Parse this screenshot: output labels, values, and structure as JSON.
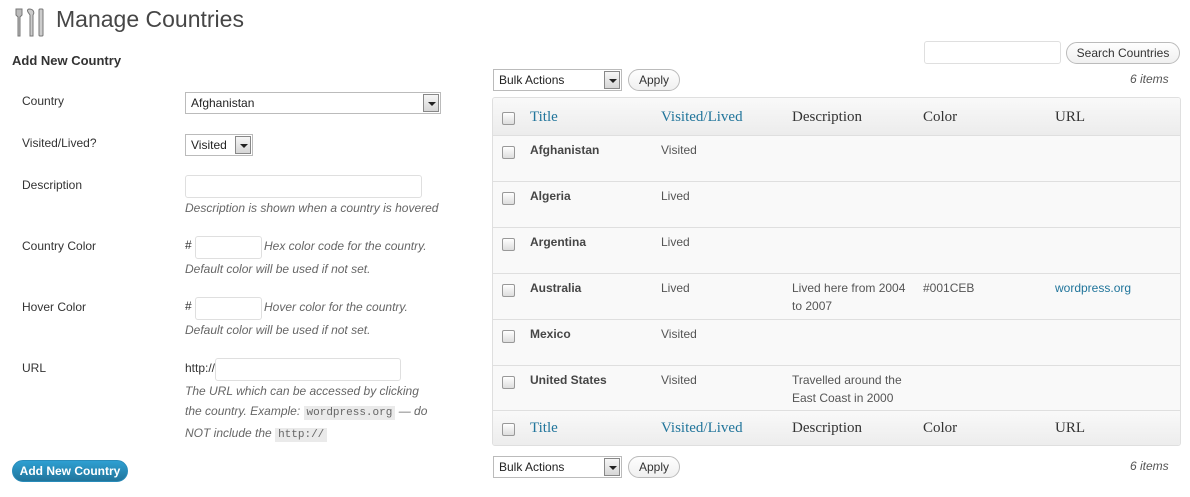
{
  "header": {
    "title": "Manage Countries",
    "icon": "tools-icon"
  },
  "form": {
    "heading": "Add New Country",
    "country_label": "Country",
    "country_value": "Afghanistan",
    "visited_label": "Visited/Lived?",
    "visited_value": "Visited",
    "description_label": "Description",
    "description_value": "",
    "description_hint": "Description is shown when a country is hovered",
    "country_color_label": "Country Color",
    "country_color_prefix": "#",
    "country_color_value": "",
    "country_color_hint_1": "Hex color code for the country.",
    "country_color_hint_2": "Default color will be used if not set.",
    "hover_color_label": "Hover Color",
    "hover_color_prefix": "#",
    "hover_color_value": "",
    "hover_color_hint_1": "Hover color for the country.",
    "hover_color_hint_2": "Default color will be used if not set.",
    "url_label": "URL",
    "url_prefix": "http://",
    "url_value": "",
    "url_hint_1": "The URL which can be accessed by clicking",
    "url_hint_2a": "the country. Example:",
    "url_hint_2_code": "wordpress.org",
    "url_hint_2b": "— do",
    "url_hint_3a": "NOT include the",
    "url_hint_3_code": "http://",
    "submit_label": "Add New Country"
  },
  "search": {
    "value": "",
    "button_label": "Search Countries"
  },
  "bulk": {
    "top_label": "Bulk Actions",
    "top_apply": "Apply",
    "bottom_label": "Bulk Actions",
    "bottom_apply": "Apply",
    "items_count_top": "6 items",
    "items_count_bottom": "6 items"
  },
  "table": {
    "columns": [
      "Title",
      "Visited/Lived",
      "Description",
      "Color",
      "URL"
    ],
    "rows": [
      {
        "title": "Afghanistan",
        "visited": "Visited",
        "description_1": "",
        "description_2": "",
        "color": "",
        "url": ""
      },
      {
        "title": "Algeria",
        "visited": "Lived",
        "description_1": "",
        "description_2": "",
        "color": "",
        "url": ""
      },
      {
        "title": "Argentina",
        "visited": "Lived",
        "description_1": "",
        "description_2": "",
        "color": "",
        "url": ""
      },
      {
        "title": "Australia",
        "visited": "Lived",
        "description_1": "Lived here from 2004",
        "description_2": "to 2007",
        "color": "#001CEB",
        "url": "wordpress.org"
      },
      {
        "title": "Mexico",
        "visited": "Visited",
        "description_1": "",
        "description_2": "",
        "color": "",
        "url": ""
      },
      {
        "title": "United States",
        "visited": "Visited",
        "description_1": "Travelled around the",
        "description_2": "East Coast in 2000",
        "color": "",
        "url": ""
      }
    ]
  },
  "colors": {
    "link": "#21759b",
    "primary_button": "#21759b"
  }
}
